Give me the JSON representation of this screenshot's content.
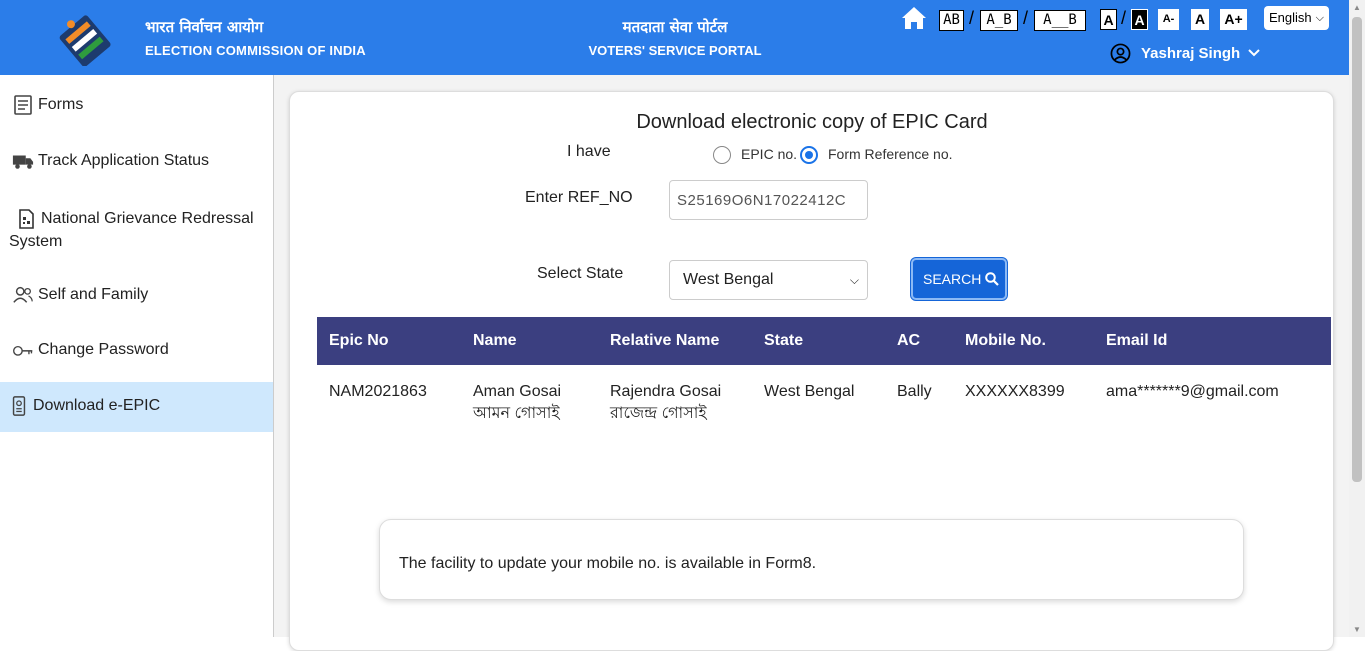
{
  "header": {
    "org_hi": "भारत निर्वाचन आयोग",
    "org_en": "ELECTION COMMISSION OF INDIA",
    "portal_hi": "मतदाता सेवा पोर्टल",
    "portal_en": "VOTERS' SERVICE PORTAL",
    "spacing_options": [
      "AB",
      "A_B",
      "A__B"
    ],
    "font_options": [
      "A",
      "A",
      "A-",
      "A",
      "A+"
    ],
    "language": "English",
    "user_name": "Yashraj Singh",
    "colors": {
      "header_bg": "#2b7de9",
      "active_nav": "#cfe8fd",
      "table_head": "#3b3f80",
      "primary": "#1565d8"
    }
  },
  "sidebar": {
    "items": [
      {
        "label": "Forms",
        "icon": "form-icon"
      },
      {
        "label": "Track Application Status",
        "icon": "truck-icon"
      },
      {
        "label": "National Grievance Redressal",
        "label2": "System",
        "icon": "document-icon"
      },
      {
        "label": "Self and Family",
        "icon": "users-icon"
      },
      {
        "label": "Change Password",
        "icon": "key-icon"
      },
      {
        "label": "Download e-EPIC",
        "icon": "id-card-icon",
        "active": true
      }
    ]
  },
  "main": {
    "title": "Download electronic copy of EPIC Card",
    "i_have_label": "I have",
    "radio_epic": "EPIC no.",
    "radio_ref": "Form Reference no.",
    "selected_radio": "Form Reference no.",
    "ref_label": "Enter REF_NO",
    "ref_value": "S25169O6N17022412C",
    "state_label": "Select State",
    "state_value": "West Bengal",
    "search_label": "SEARCH"
  },
  "table": {
    "headers": [
      "Epic No",
      "Name",
      "Relative Name",
      "State",
      "AC",
      "Mobile No.",
      "Email Id"
    ],
    "rows": [
      {
        "epic_no": "NAM2021863",
        "name": "Aman Gosai",
        "name_local": "আমন গোসাই",
        "relative_name": "Rajendra Gosai",
        "relative_local": "রাজেন্দ্র গোসাই",
        "state": "West Bengal",
        "ac": "Bally",
        "mobile": "XXXXXX8399",
        "email": "ama*******9@gmail.com"
      }
    ]
  },
  "notice": {
    "text": "The facility to update your mobile no. is available in Form8."
  }
}
